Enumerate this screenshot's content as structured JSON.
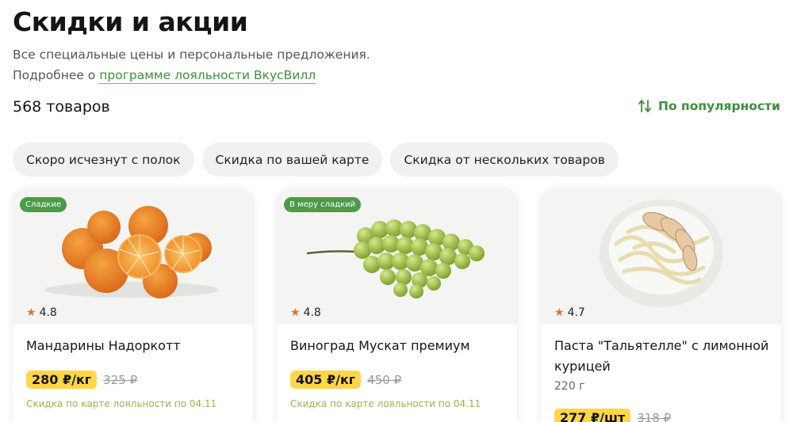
{
  "header": {
    "title": "Скидки и акции",
    "subtitle_line1": "Все специальные цены и персональные предложения.",
    "subtitle_prefix": "Подробнее о ",
    "subtitle_link": "программе лояльности ВкусВилл"
  },
  "toolbar": {
    "count": "568 товаров",
    "sort_label": "По популярности",
    "sort_icon": "sort-arrows-icon"
  },
  "filters": [
    "Скоро исчезнут с полок",
    "Скидка по вашей карте",
    "Скидка от нескольких товаров"
  ],
  "products": [
    {
      "badge": "Сладкие",
      "rating": "4.8",
      "name": "Мандарины Надоркотт",
      "price": "280 ₽/кг",
      "old_price": "325 ₽",
      "promo": "Скидка по карте лояльности по 04.11"
    },
    {
      "badge": "В меру сладкий",
      "rating": "4.8",
      "name": "Виноград Мускат премиум",
      "price": "405 ₽/кг",
      "old_price": "450 ₽",
      "promo": "Скидка по карте лояльности по 04.11"
    },
    {
      "rating": "4.7",
      "name": "Паста \"Тальятелле\" с лимонной курицей",
      "weight": "220 г",
      "price": "277 ₽/шт",
      "old_price": "318 ₽"
    }
  ],
  "colors": {
    "accent_green": "#3f8f3a",
    "price_yellow": "#ffd64a",
    "badge_green": "#4c9a4a",
    "star": "#d4782c"
  }
}
